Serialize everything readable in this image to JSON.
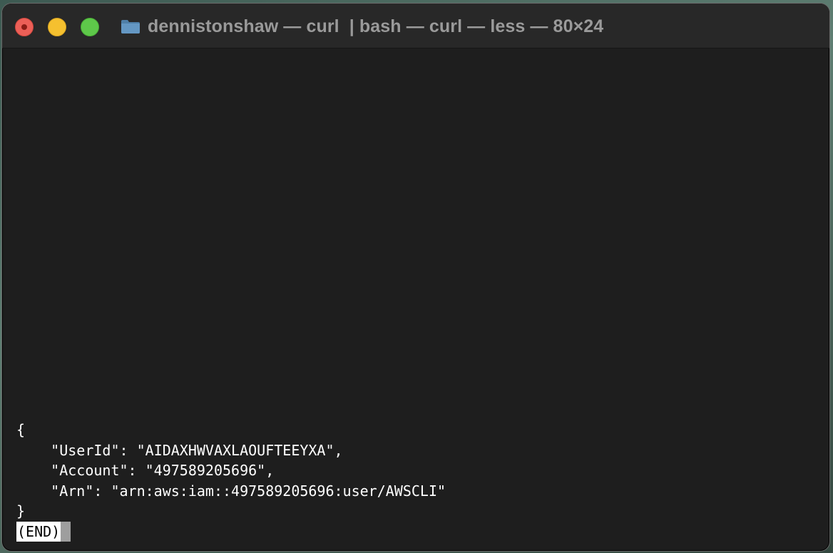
{
  "window": {
    "title": "dennistonshaw — curl  | bash — curl — less — 80×24",
    "title_icon": "folder-icon",
    "traffic_lights": {
      "close_color": "#ec5f57",
      "minimize_color": "#f5c02f",
      "maximize_color": "#5ec84a"
    }
  },
  "terminal": {
    "background": "#1e1e1e",
    "foreground": "#ffffff",
    "lines": [
      "{",
      "    \"UserId\": \"AIDAXHWVAXLAOUFTEEYXA\",",
      "    \"Account\": \"497589205696\",",
      "    \"Arn\": \"arn:aws:iam::497589205696:user/AWSCLI\"",
      "}"
    ],
    "pager_status": "(END)"
  }
}
